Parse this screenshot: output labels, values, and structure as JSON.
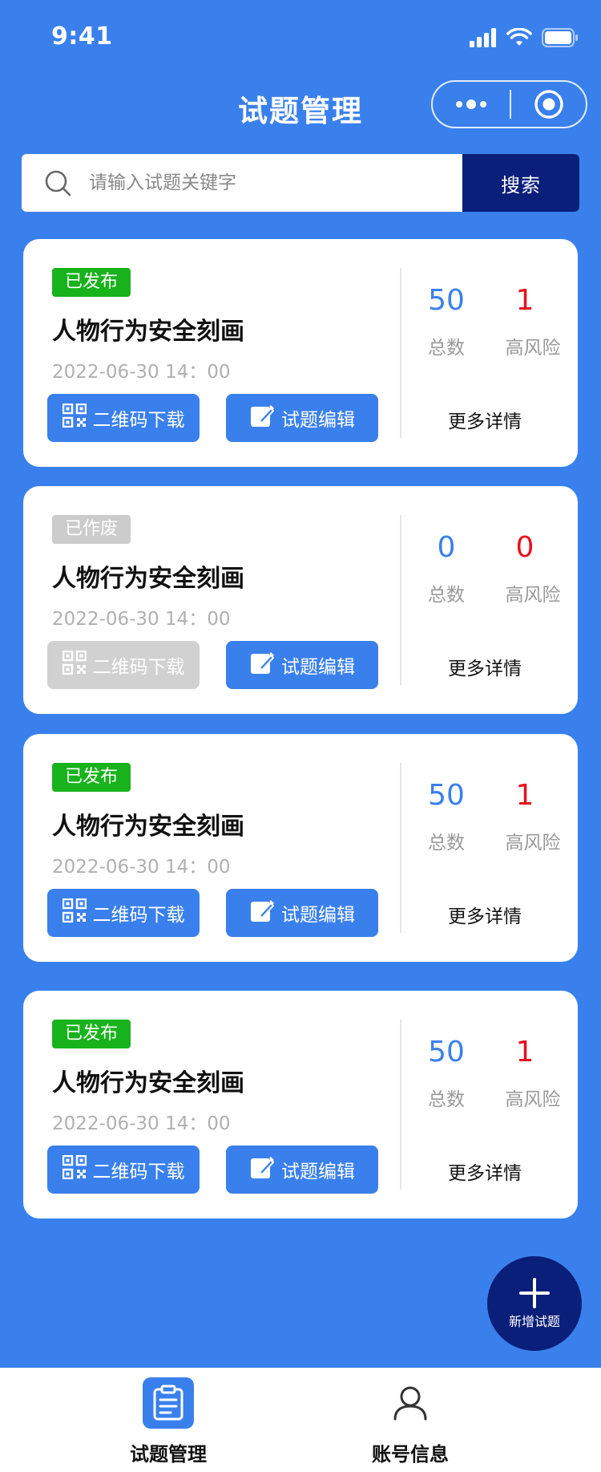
{
  "status_bar": {
    "time": "9:41"
  },
  "nav": {
    "title": "试题管理"
  },
  "search": {
    "placeholder": "请输入试题关键字",
    "button_label": "搜索"
  },
  "cards": [
    {
      "status": "已发布",
      "title": "人物行为安全刻画",
      "time": "2022-06-30 14：00",
      "qr_label": "二维码下载",
      "edit_label": "试题编辑",
      "total": "50",
      "total_label": "总数",
      "risk": "1",
      "risk_label": "高风险",
      "more_label": "更多详情"
    },
    {
      "status": "已作废",
      "title": "人物行为安全刻画",
      "time": "2022-06-30 14：00",
      "qr_label": "二维码下载",
      "edit_label": "试题编辑",
      "total": "0",
      "total_label": "总数",
      "risk": "0",
      "risk_label": "高风险",
      "more_label": "更多详情"
    },
    {
      "status": "已发布",
      "title": "人物行为安全刻画",
      "time": "2022-06-30 14：00",
      "qr_label": "二维码下载",
      "edit_label": "试题编辑",
      "total": "50",
      "total_label": "总数",
      "risk": "1",
      "risk_label": "高风险",
      "more_label": "更多详情"
    },
    {
      "status": "已发布",
      "title": "人物行为安全刻画",
      "time": "2022-06-30 14：00",
      "qr_label": "二维码下载",
      "edit_label": "试题编辑",
      "total": "50",
      "total_label": "总数",
      "risk": "1",
      "risk_label": "高风险",
      "more_label": "更多详情"
    }
  ],
  "fab": {
    "label": "新增试题"
  },
  "tabs": [
    {
      "label": "试题管理",
      "icon": "clipboard-icon",
      "active": true
    },
    {
      "label": "账号信息",
      "icon": "user-icon",
      "active": false
    }
  ],
  "colors": {
    "primary": "#3a80ec",
    "dark": "#0a1f7a",
    "published": "#18b31c",
    "voided": "#cccccc",
    "risk": "#e8101e"
  }
}
